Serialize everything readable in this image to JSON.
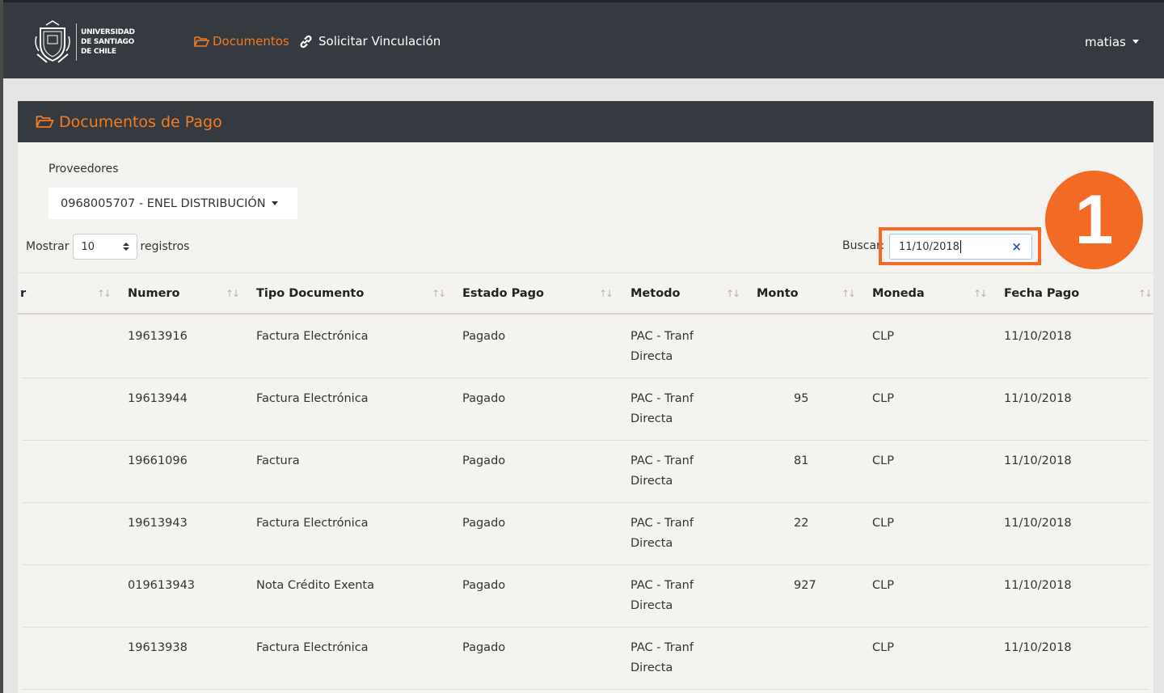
{
  "navbar": {
    "logo_lines": [
      "UNIVERSIDAD",
      "DE SANTIAGO",
      "DE CHILE"
    ],
    "nav_documentos": "Documentos",
    "nav_vinculacion": "Solicitar Vinculación",
    "user": "matias"
  },
  "card": {
    "title": "Documentos de Pago",
    "proveedores_label": "Proveedores",
    "proveedor_selected": "0968005707 - ENEL DISTRIBUCIÓN"
  },
  "table_controls": {
    "mostrar_label": "Mostrar",
    "page_size": "10",
    "registros_label": "registros",
    "buscar_label": "Buscar:",
    "search_value": "11/10/2018"
  },
  "annotation": {
    "step": "1"
  },
  "table": {
    "columns": [
      "r",
      "Numero",
      "Tipo Documento",
      "Estado Pago",
      "Metodo",
      "Monto",
      "Moneda",
      "Fecha Pago"
    ],
    "rows": [
      {
        "numero": "19613916",
        "tipo": "Factura Electrónica",
        "estado": "Pagado",
        "metodo1": "PAC - Tranf",
        "metodo2": "Directa",
        "monto": "",
        "moneda": "CLP",
        "fecha": "11/10/2018"
      },
      {
        "numero": "19613944",
        "tipo": "Factura Electrónica",
        "estado": "Pagado",
        "metodo1": "PAC - Tranf",
        "metodo2": "Directa",
        "monto": "95",
        "moneda": "CLP",
        "fecha": "11/10/2018"
      },
      {
        "numero": "19661096",
        "tipo": "Factura",
        "estado": "Pagado",
        "metodo1": "PAC - Tranf",
        "metodo2": "Directa",
        "monto": "81",
        "moneda": "CLP",
        "fecha": "11/10/2018"
      },
      {
        "numero": "19613943",
        "tipo": "Factura Electrónica",
        "estado": "Pagado",
        "metodo1": "PAC - Tranf",
        "metodo2": "Directa",
        "monto": "22",
        "moneda": "CLP",
        "fecha": "11/10/2018"
      },
      {
        "numero": "019613943",
        "tipo": "Nota Crédito Exenta",
        "estado": "Pagado",
        "metodo1": "PAC - Tranf",
        "metodo2": "Directa",
        "monto": "927",
        "moneda": "CLP",
        "fecha": "11/10/2018"
      },
      {
        "numero": "19613938",
        "tipo": "Factura Electrónica",
        "estado": "Pagado",
        "metodo1": "PAC - Tranf",
        "metodo2": "Directa",
        "monto": "",
        "moneda": "CLP",
        "fecha": "11/10/2018"
      }
    ]
  },
  "colors": {
    "accent": "#f47b20",
    "navbar": "#353a40",
    "annotation": "#f26a23",
    "card_bg": "#f5f3ef"
  },
  "icons": [
    "folder-open-icon",
    "link-icon",
    "caret-down-icon",
    "sort-icon",
    "clear-icon"
  ]
}
